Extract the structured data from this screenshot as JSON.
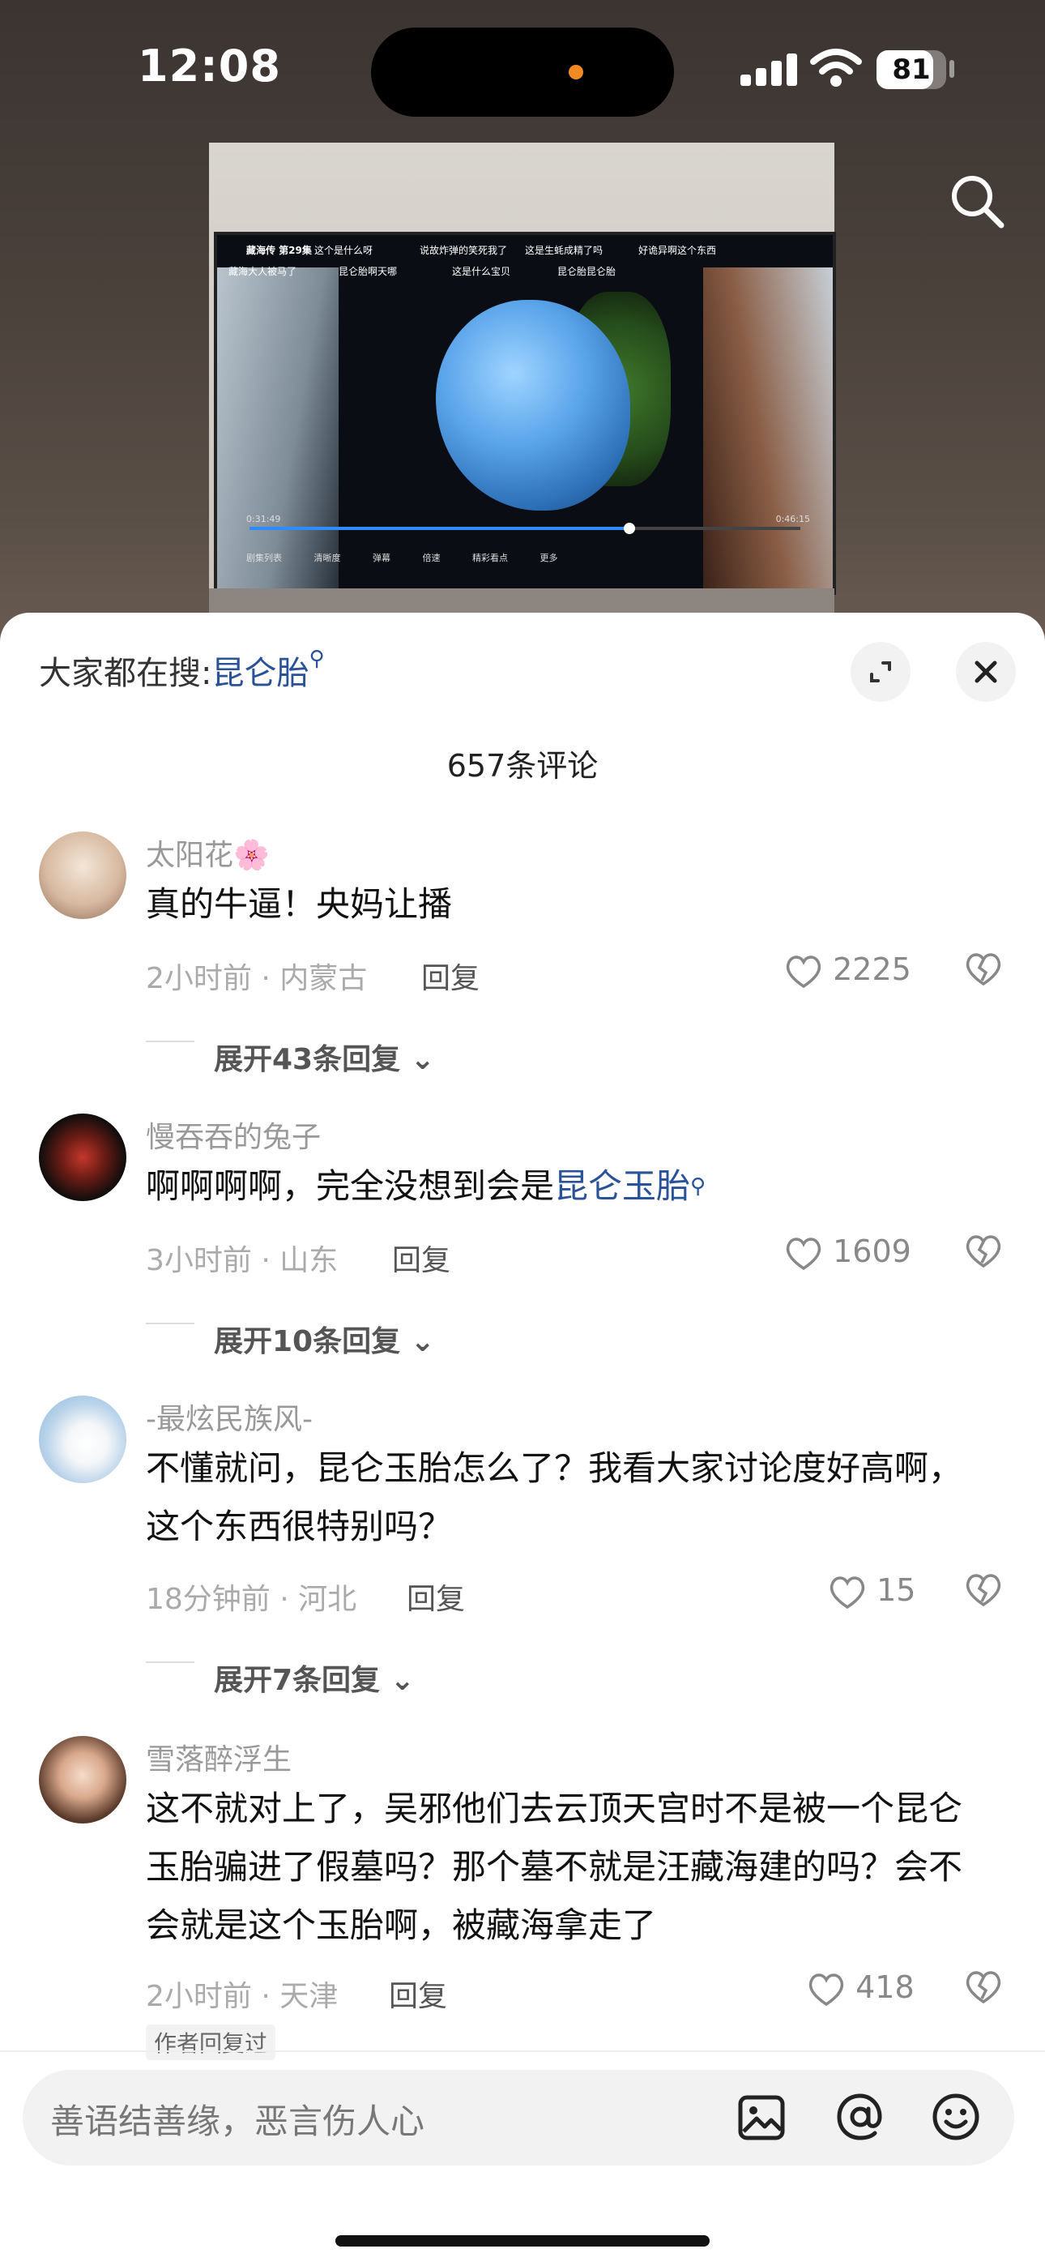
{
  "status_bar": {
    "time": "12:08",
    "battery": "81",
    "battery_level": 0.81
  },
  "video": {
    "danmu": [
      "藏海传 第29集",
      "这个是什么呀",
      "说故炸弹的笑死我了",
      "这是生蚝成精了吗",
      "好诡异啊这个东西",
      "藏海大人被马了",
      "昆仑胎啊天哪",
      "这是什么宝贝",
      "昆仑胎昆仑胎"
    ],
    "time_current": "0:31:49",
    "time_total": "0:46:15",
    "progress": 0.69,
    "controls": [
      "剧集列表",
      "清晰度",
      "弹幕",
      "倍速",
      "精彩看点",
      "更多"
    ]
  },
  "sheet": {
    "hot_search_label": "大家都在搜:",
    "hot_search_keyword": "昆仑胎",
    "comment_count": "657条评论",
    "comments": [
      {
        "name": "太阳花🌸",
        "text": "真的牛逼！央妈让播",
        "meta": "2小时前 · 内蒙古",
        "reply": "回复",
        "likes": "2225",
        "expand": "展开43条回复"
      },
      {
        "name": "慢吞吞的兔子",
        "text_before": "啊啊啊啊，完全没想到会是",
        "keyword": "昆仑玉胎",
        "meta": "3小时前 · 山东",
        "reply": "回复",
        "likes": "1609",
        "expand": "展开10条回复"
      },
      {
        "name": "-最炫民族风-",
        "text_line1": "不懂就问，昆仑玉胎怎么了？我看大家讨论度好高啊，",
        "text_line2": "这个东西很特别吗？",
        "meta": "18分钟前 · 河北",
        "reply": "回复",
        "likes": "15",
        "expand": "展开7条回复"
      },
      {
        "name": "雪落醉浮生",
        "text_line1": "这不就对上了，吴邪他们去云顶天宫时不是被一个昆仑",
        "text_line2": "玉胎骗进了假墓吗？那个墓不就是汪藏海建的吗？会不",
        "text_line3": "会就是这个玉胎啊，被藏海拿走了",
        "meta": "2小时前 · 天津",
        "reply": "回复",
        "likes": "418",
        "author_tag": "作者回复过"
      }
    ]
  },
  "input": {
    "placeholder": "善语结善缘，恶言伤人心"
  }
}
